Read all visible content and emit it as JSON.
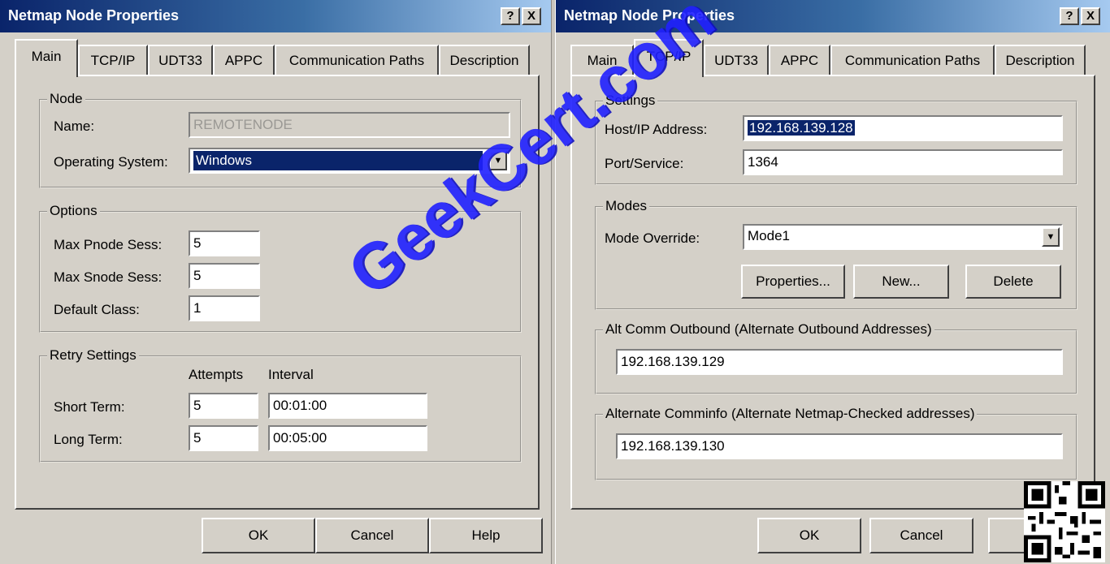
{
  "left_dialog": {
    "title": "Netmap Node Properties",
    "help_btn": "?",
    "close_btn": "X",
    "tabs": [
      "Main",
      "TCP/IP",
      "UDT33",
      "APPC",
      "Communication Paths",
      "Description"
    ],
    "node": {
      "group": "Node",
      "name_label": "Name:",
      "name_value": "REMOTENODE",
      "os_label": "Operating System:",
      "os_value": "Windows"
    },
    "options": {
      "group": "Options",
      "max_pnode_label": "Max Pnode Sess:",
      "max_pnode_value": "5",
      "max_snode_label": "Max Snode Sess:",
      "max_snode_value": "5",
      "default_class_label": "Default Class:",
      "default_class_value": "1"
    },
    "retry": {
      "group": "Retry Settings",
      "attempts_header": "Attempts",
      "interval_header": "Interval",
      "short_label": "Short Term:",
      "short_attempts": "5",
      "short_interval": "00:01:00",
      "long_label": "Long Term:",
      "long_attempts": "5",
      "long_interval": "00:05:00"
    },
    "buttons": {
      "ok": "OK",
      "cancel": "Cancel",
      "help": "Help"
    }
  },
  "right_dialog": {
    "title": "Netmap Node Properties",
    "help_btn": "?",
    "close_btn": "X",
    "tabs": [
      "Main",
      "TCP/IP",
      "UDT33",
      "APPC",
      "Communication Paths",
      "Description"
    ],
    "settings": {
      "group": "Settings",
      "host_label": "Host/IP Address:",
      "host_value": "192.168.139.128",
      "port_label": "Port/Service:",
      "port_value": "1364"
    },
    "modes": {
      "group": "Modes",
      "override_label": "Mode Override:",
      "override_value": "Mode1",
      "properties_btn": "Properties...",
      "new_btn": "New...",
      "delete_btn": "Delete"
    },
    "alt_comm": {
      "group": "Alt Comm Outbound  (Alternate Outbound Addresses)",
      "value": "192.168.139.129"
    },
    "alt_comminfo": {
      "group": "Alternate Comminfo  (Alternate Netmap-Checked addresses)",
      "value": "192.168.139.130"
    },
    "buttons": {
      "ok": "OK",
      "cancel": "Cancel"
    }
  },
  "watermark": "GeekCert.com",
  "colors": {
    "titlebar": "#0a246a",
    "face": "#d4d0c8",
    "selection": "#0a246a",
    "watermark": "#2020ff"
  }
}
